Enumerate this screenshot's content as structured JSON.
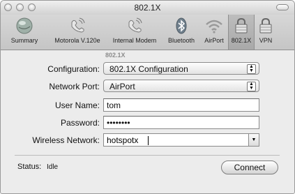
{
  "window": {
    "title": "802.1X"
  },
  "toolbar": {
    "items": [
      {
        "label": "Summary",
        "icon": "summary-icon"
      },
      {
        "label": "Motorola V.120e",
        "icon": "phone-icon"
      },
      {
        "label": "Internal Modem",
        "icon": "phone-icon"
      },
      {
        "label": "Bluetooth",
        "icon": "bluetooth-icon"
      },
      {
        "label": "AirPort",
        "icon": "airport-icon"
      },
      {
        "label": "802.1X",
        "icon": "lock-icon",
        "selected": true
      },
      {
        "label": "VPN",
        "icon": "lock-icon"
      }
    ]
  },
  "form": {
    "section_header": "802.1X",
    "configuration": {
      "label": "Configuration:",
      "value": "802.1X Configuration"
    },
    "network_port": {
      "label": "Network Port:",
      "value": "AirPort"
    },
    "user_name": {
      "label": "User Name:",
      "value": "tom"
    },
    "password": {
      "label": "Password:",
      "value": "••••••••"
    },
    "wireless_network": {
      "label": "Wireless Network:",
      "value": "hotspotx"
    }
  },
  "footer": {
    "status_label": "Status:",
    "status_value": "Idle",
    "connect_label": "Connect"
  },
  "colors": {
    "window_bg": "#ececec",
    "toolbar_bg": "#c5c5c5"
  }
}
